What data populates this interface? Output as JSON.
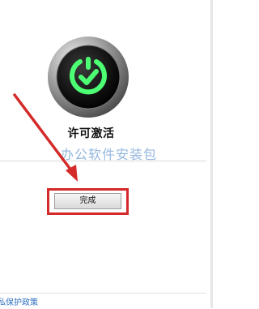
{
  "status": {
    "title": "许可激活"
  },
  "watermark": {
    "text": "办公软件安装包"
  },
  "actions": {
    "finish_label": "完成"
  },
  "footer": {
    "privacy_label": "私保护政策"
  },
  "icons": {
    "badge": "power-check-icon",
    "arrow": "red-arrow-annotation"
  },
  "colors": {
    "badge_green": "#4cff73",
    "annotation_red": "#d42a2a",
    "link_blue": "#2f6fbf",
    "watermark_blue": "#8fb4dd"
  }
}
